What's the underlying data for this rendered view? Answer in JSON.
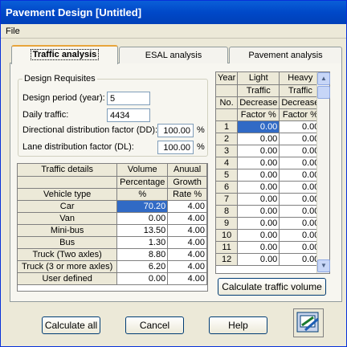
{
  "window": {
    "title": "Pavement Design [Untitled]"
  },
  "menu": [
    "File"
  ],
  "tabs": [
    "Traffic analysis",
    "ESAL analysis",
    "Pavement analysis"
  ],
  "design_requisites": {
    "title": "Design Requisites",
    "design_period_label": "Design period (year):",
    "design_period_value": "5",
    "daily_traffic_label": "Daily traffic:",
    "daily_traffic_value": "4434",
    "dd_label": "Directional distribution factor (DD):",
    "dd_value": "100.00",
    "dl_label": "Lane distribution factor (DL):",
    "dl_value": "100.00",
    "unit": "%"
  },
  "traffic_table": {
    "headers": {
      "r1": [
        "Traffic details",
        "Volume",
        "Anuual"
      ],
      "r2": [
        "",
        "Percentage",
        "Growth"
      ],
      "r3": [
        "Vehicle type",
        "%",
        "Rate %"
      ]
    },
    "rows": [
      {
        "type": "Car",
        "pct": "70.20",
        "rate": "4.00"
      },
      {
        "type": "Van",
        "pct": "0.00",
        "rate": "4.00"
      },
      {
        "type": "Mini-bus",
        "pct": "13.50",
        "rate": "4.00"
      },
      {
        "type": "Bus",
        "pct": "1.30",
        "rate": "4.00"
      },
      {
        "type": "Truck (Two axles)",
        "pct": "8.80",
        "rate": "4.00"
      },
      {
        "type": "Truck (3 or more axles)",
        "pct": "6.20",
        "rate": "4.00"
      },
      {
        "type": "User defined",
        "pct": "0.00",
        "rate": "4.00"
      }
    ]
  },
  "decrease_table": {
    "headers": {
      "r1": [
        "Year",
        "Light",
        "Heavy"
      ],
      "r2": [
        "",
        "Traffic",
        "Traffic"
      ],
      "r3": [
        "No.",
        "Decrease",
        "Decrease"
      ],
      "r4": [
        "",
        "Factor %",
        "Factor %"
      ]
    },
    "rows": [
      {
        "year": "1",
        "light": "0.00",
        "heavy": "0.00"
      },
      {
        "year": "2",
        "light": "0.00",
        "heavy": "0.00"
      },
      {
        "year": "3",
        "light": "0.00",
        "heavy": "0.00"
      },
      {
        "year": "4",
        "light": "0.00",
        "heavy": "0.00"
      },
      {
        "year": "5",
        "light": "0.00",
        "heavy": "0.00"
      },
      {
        "year": "6",
        "light": "0.00",
        "heavy": "0.00"
      },
      {
        "year": "7",
        "light": "0.00",
        "heavy": "0.00"
      },
      {
        "year": "8",
        "light": "0.00",
        "heavy": "0.00"
      },
      {
        "year": "9",
        "light": "0.00",
        "heavy": "0.00"
      },
      {
        "year": "10",
        "light": "0.00",
        "heavy": "0.00"
      },
      {
        "year": "11",
        "light": "0.00",
        "heavy": "0.00"
      },
      {
        "year": "12",
        "light": "0.00",
        "heavy": "0.00"
      }
    ]
  },
  "buttons": {
    "calc_traffic": "Calculate traffic volume",
    "calc_all": "Calculate all",
    "cancel": "Cancel",
    "help": "Help"
  },
  "icons": {
    "tool": "chart-tool-icon"
  },
  "colors": {
    "selection": "#316ac5",
    "titlebar": "#0048c8"
  }
}
